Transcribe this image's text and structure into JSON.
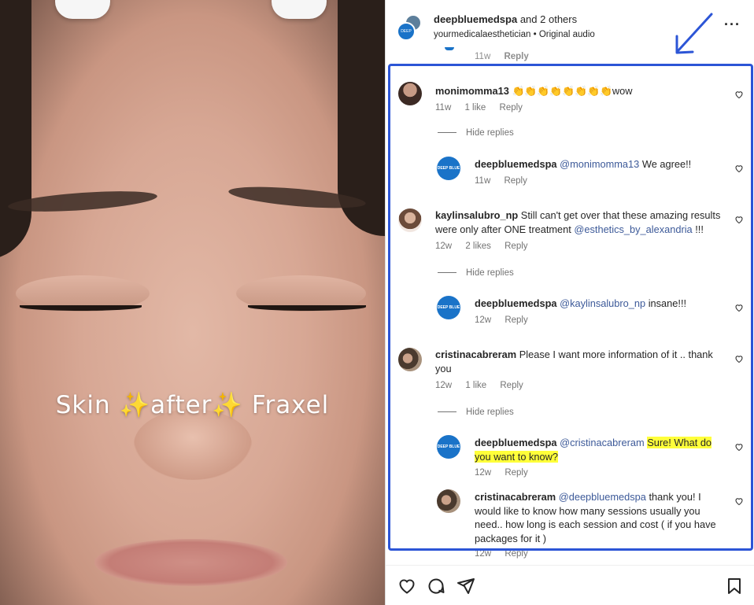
{
  "media": {
    "overlay_text": "Skin ✨after✨ Fraxel"
  },
  "header": {
    "username": "deepbluemedspa",
    "and_others": "and 2 others",
    "sub_account": "yourmedicalaesthetician",
    "sub_separator": "•",
    "audio": "Original audio",
    "more_icon": "more-horizontal-icon"
  },
  "peek": {
    "time": "11w",
    "reply": "Reply"
  },
  "comments": [
    {
      "user": "monimomma13",
      "text": "👏👏👏👏👏👏👏👏wow",
      "time": "11w",
      "likes": "1 like",
      "reply": "Reply",
      "hide": "Hide replies",
      "replies": [
        {
          "user": "deepbluemedspa",
          "mention": "@monimomma13",
          "text": " We agree!!",
          "time": "11w",
          "reply": "Reply"
        }
      ]
    },
    {
      "user": "kaylinsalubro_np",
      "text": " Still can't get over that these amazing results were only after ONE treatment ",
      "mention": "@esthetics_by_alexandria",
      "tail": " !!!",
      "time": "12w",
      "likes": "2 likes",
      "reply": "Reply",
      "hide": "Hide replies",
      "replies": [
        {
          "user": "deepbluemedspa",
          "mention": "@kaylinsalubro_np",
          "text": " insane!!!",
          "time": "12w",
          "reply": "Reply"
        }
      ]
    },
    {
      "user": "cristinacabreram",
      "text": " Please I want more information of it .. thank you",
      "time": "12w",
      "likes": "1 like",
      "reply": "Reply",
      "hide": "Hide replies",
      "replies": [
        {
          "user": "deepbluemedspa",
          "mention": "@cristinacabreram",
          "highlight": "Sure! What do you want to know?",
          "time": "12w",
          "reply": "Reply"
        },
        {
          "user": "cristinacabreram",
          "mention": "@deepbluemedspa",
          "text": " thank you! I would like to know how many sessions usually you need.. how long is each session and cost ( if you have packages for it )",
          "time": "12w",
          "reply": "Reply"
        }
      ]
    }
  ],
  "actions": {
    "like": "heart-icon",
    "comment": "comment-icon",
    "share": "send-icon",
    "save": "bookmark-icon"
  },
  "colors": {
    "annotation_box": "#2c55d6",
    "highlight": "#ffff3a",
    "mention": "#3d5a99",
    "brand": "#1a73c8"
  }
}
